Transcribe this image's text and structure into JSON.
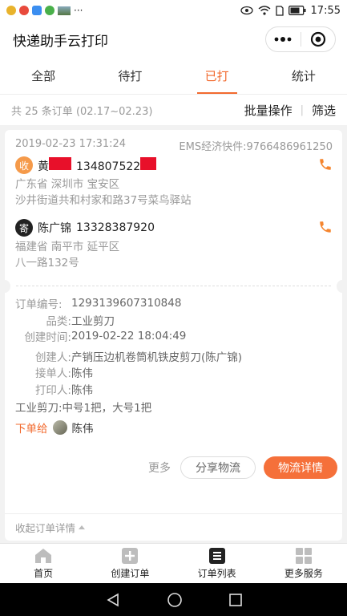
{
  "status_bar": {
    "time": "17:55",
    "battery": "battery-icon",
    "signal_icons": [
      "eye-icon",
      "wifi-icon",
      "sim-icon"
    ],
    "left_icons": [
      "app-icon-1",
      "app-icon-2",
      "app-icon-3",
      "app-icon-4",
      "image-thumb-icon"
    ],
    "overflow": "···"
  },
  "app": {
    "title": "快递助手云打印"
  },
  "tabs": [
    {
      "label": "全部",
      "active": false
    },
    {
      "label": "待打",
      "active": false
    },
    {
      "label": "已打",
      "active": true
    },
    {
      "label": "统计",
      "active": false
    }
  ],
  "summary": {
    "text": "共 25 条订单 (02.17~02.23)",
    "batch_label": "批量操作",
    "filter_label": "筛选",
    "separator": "|"
  },
  "order": {
    "created_at": "2019-02-23 17:31:24",
    "tracking": "EMS经济快件:9766486961250",
    "sender": {
      "badge": "收",
      "name": "黄",
      "phone": "134807522",
      "address_line1": "广东省 深圳市 宝安区",
      "address_line2": "沙井街道共和村家和路37号菜鸟驿站"
    },
    "receiver": {
      "badge": "寄",
      "name": "陈广锦",
      "phone": "13328387920",
      "address_line1": "福建省 南平市 延平区",
      "address_line2": "八一路132号"
    },
    "details": {
      "order_no_label": "订单编号:",
      "order_no": "1293139607310848",
      "category_label": "品类:",
      "category": "工业剪刀",
      "create_time_label": "创建时间:",
      "create_time": "2019-02-22 18:04:49",
      "creator_label": "创建人:",
      "creator": "产销压边机卷筒机铁皮剪刀(陈广锦)",
      "taker_label": "接单人:",
      "taker": "陈伟",
      "printer_label": "打印人:",
      "printer": "陈伟"
    },
    "note": "工业剪刀:中号1把，大号1把",
    "assigned_label": "下单给",
    "assigned_to": "陈伟",
    "more_label": "更多",
    "share_label": "分享物流",
    "logistics_label": "物流详情",
    "collapse_label": "收起订单详情"
  },
  "bottom_nav": [
    {
      "label": "首页",
      "icon": "home-icon"
    },
    {
      "label": "创建订单",
      "icon": "plus-square-icon"
    },
    {
      "label": "订单列表",
      "icon": "list-icon"
    },
    {
      "label": "更多服务",
      "icon": "grid-icon"
    }
  ],
  "colors": {
    "accent": "#f26a2e",
    "primary_button": "#f5703a",
    "redaction": "#e8102a"
  }
}
